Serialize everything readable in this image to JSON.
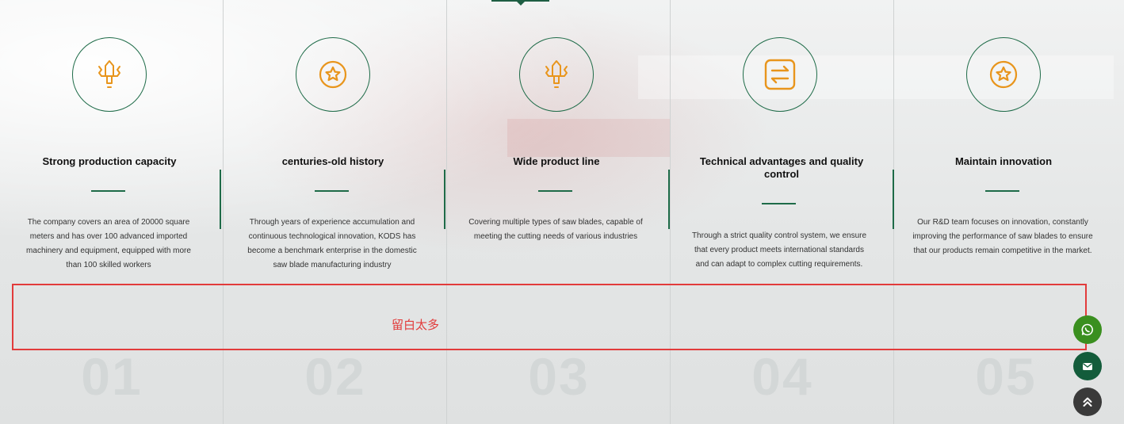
{
  "features": [
    {
      "title": "Strong production capacity",
      "text": "The company covers an area of 20000 square meters and has over 100 advanced imported machinery and equipment, equipped with more than 100 skilled workers",
      "number": "01",
      "icon": "sword-icon"
    },
    {
      "title": "centuries-old history",
      "text": "Through years of experience accumulation and continuous technological innovation, KODS has become a benchmark enterprise in the domestic saw blade manufacturing industry",
      "number": "02",
      "icon": "star-badge-icon"
    },
    {
      "title": "Wide product line",
      "text": "Covering multiple types of saw blades, capable of meeting the cutting needs of various industries",
      "number": "03",
      "icon": "sword-icon"
    },
    {
      "title": "Technical advantages and quality control",
      "text": "Through a strict quality control system, we ensure that every product meets international standards and can adapt to complex cutting requirements.",
      "number": "04",
      "icon": "exchange-icon"
    },
    {
      "title": "Maintain innovation",
      "text": "Our R&D team focuses on innovation, constantly improving the performance of saw blades to ensure that our products remain competitive in the market.",
      "number": "05",
      "icon": "star-badge-icon"
    }
  ],
  "annotation": {
    "text": "留白太多",
    "color": "#e23b3b"
  },
  "floating_buttons": [
    {
      "name": "whatsapp-button",
      "icon": "whatsapp-icon",
      "color": "#3a8f1f"
    },
    {
      "name": "email-button",
      "icon": "mail-icon",
      "color": "#135c3b"
    },
    {
      "name": "back-to-top-button",
      "icon": "double-chevron-up-icon",
      "color": "#3a3a3a"
    }
  ],
  "colors": {
    "accent": "#1e6b48",
    "icon": "#e8951c"
  }
}
